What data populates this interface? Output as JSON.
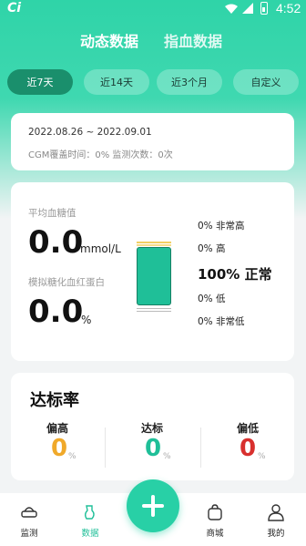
{
  "status_bar": {
    "app_logo": "Ci",
    "time": "4:52"
  },
  "main_tabs": [
    {
      "label": "动态数据"
    },
    {
      "label": "指血数据"
    }
  ],
  "range_tabs": [
    {
      "label": "近7天"
    },
    {
      "label": "近14天"
    },
    {
      "label": "近3个月"
    },
    {
      "label": "自定义"
    }
  ],
  "date_card": {
    "range": "2022.08.26 ~ 2022.09.01",
    "cgm_text": "CGM覆盖时间：0% 监测次数：0次"
  },
  "stats": {
    "avg_label": "平均血糖值",
    "avg_value": "0.0",
    "avg_unit": "mmol/L",
    "hba1c_label": "模拟糖化血红蛋白",
    "hba1c_value": "0.0",
    "hba1c_unit": "%",
    "distribution": {
      "very_high": "0% 非常高",
      "high": "0% 高",
      "normal": "100% 正常",
      "low": "0% 低",
      "very_low": "0% 非常低"
    }
  },
  "rate": {
    "title": "达标率",
    "cols": [
      {
        "label": "偏高",
        "value": "0",
        "unit": "%",
        "color": "#f0a92a"
      },
      {
        "label": "达标",
        "value": "0",
        "unit": "%",
        "color": "#1fbf98"
      },
      {
        "label": "偏低",
        "value": "0",
        "unit": "%",
        "color": "#d8302e"
      }
    ]
  },
  "bottom_nav": [
    {
      "label": "监测",
      "icon": "monitor-icon"
    },
    {
      "label": "数据",
      "icon": "data-icon"
    },
    {
      "label": "商城",
      "icon": "shop-bag-icon"
    },
    {
      "label": "我的",
      "icon": "person-icon"
    }
  ],
  "colors": {
    "accent": "#1fbf98",
    "active_range": "#1a8f6c",
    "fab": "#28d0a6"
  }
}
